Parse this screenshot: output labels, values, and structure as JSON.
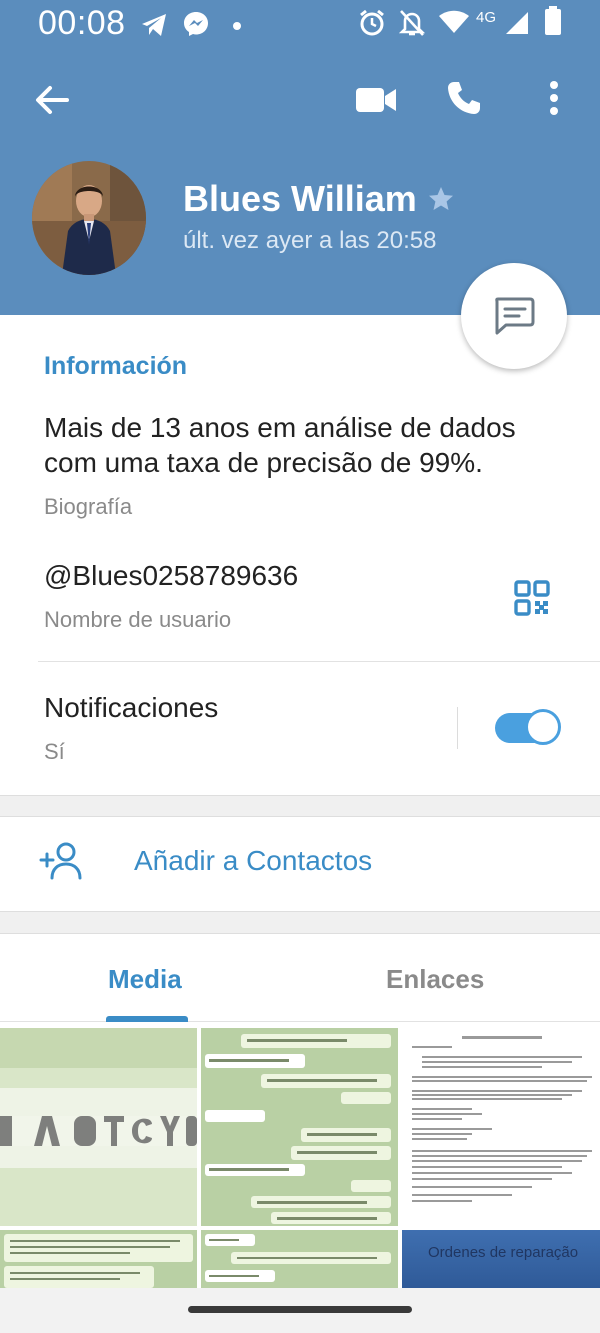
{
  "status_bar": {
    "time": "00:08",
    "network": "4G",
    "icons": [
      "telegram-icon",
      "messenger-icon",
      "dot-icon",
      "alarm-icon",
      "mute-icon",
      "wifi-icon",
      "signal-icon",
      "battery-icon"
    ]
  },
  "header": {
    "name": "Blues William",
    "last_seen": "últ. vez ayer a las 20:58",
    "verified_star": true
  },
  "info": {
    "title": "Información",
    "bio": "Mais de 13 anos em análise de dados com uma taxa de precisão de 99%.",
    "bio_label": "Biografía",
    "username": "@Blues0258789636",
    "username_label": "Nombre de usuario",
    "notifications_title": "Notificaciones",
    "notifications_value": "Sí",
    "notifications_on": true
  },
  "actions": {
    "add_contact": "Añadir a Contactos"
  },
  "tabs": {
    "items": [
      "Media",
      "Enlaces"
    ],
    "active": "Media"
  },
  "media": {
    "thumb_doc_title": "Ordenes de reparação"
  },
  "colors": {
    "header": "#5b8dbd",
    "accent": "#3a8cc6",
    "toggle": "#4aa0df"
  }
}
